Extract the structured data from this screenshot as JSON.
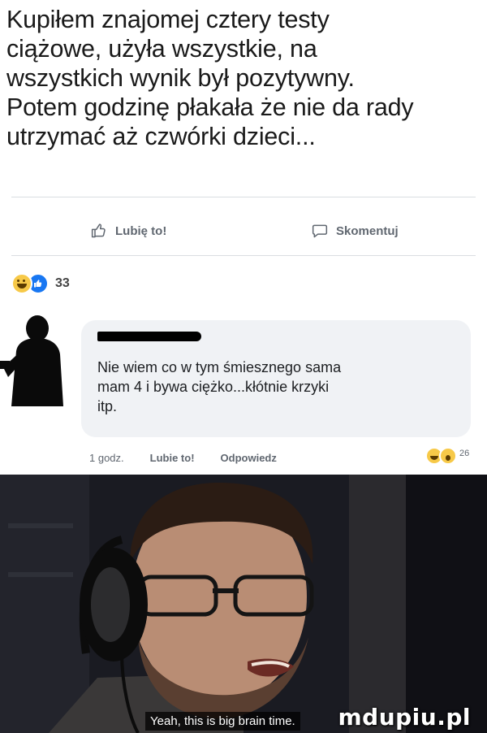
{
  "post": {
    "text_lines": [
      "Kupiłem znajomej cztery testy",
      "ciążowe, użyła wszystkie, na",
      "wszystkich wynik był pozytywny.",
      "Potem godzinę płakała że nie da rady",
      "utrzymać aż czwórki dzieci..."
    ]
  },
  "actions": {
    "like_label": "Lubię to!",
    "comment_label": "Skomentuj",
    "like_icon": "thumbs-up-icon",
    "comment_icon": "speech-bubble-icon"
  },
  "reactions": {
    "count": "33",
    "types": [
      "haha",
      "like"
    ]
  },
  "comment": {
    "author_redacted": true,
    "text_lines": [
      "Nie wiem co w tym śmiesznego sama",
      "mam 4 i bywa ciężko...kłótnie krzyki",
      "itp."
    ],
    "time": "1 godz.",
    "like_label": "Lubie to!",
    "reply_label": "Odpowiedz",
    "reaction_count": "26",
    "reaction_types": [
      "haha",
      "wow"
    ]
  },
  "meme": {
    "caption": "Yeah, this is big brain time.",
    "watermark": "mdupiu.pl"
  },
  "colors": {
    "facebook_blue": "#1877f2",
    "bubble_bg": "#f0f2f5",
    "muted_text": "#606770",
    "emoji_yellow": "#f7c948"
  }
}
